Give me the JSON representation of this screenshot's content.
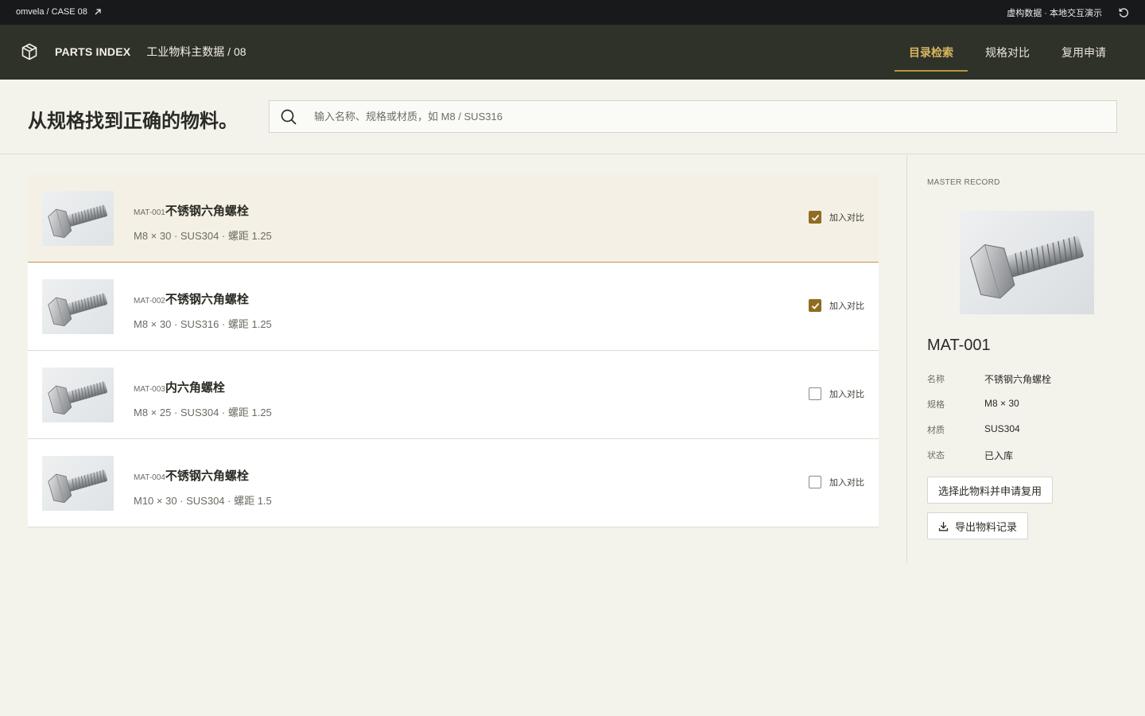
{
  "topbar": {
    "crumb": "omvela / CASE 08",
    "note": "虚构数据 · 本地交互演示"
  },
  "header": {
    "brand": "PARTS INDEX",
    "subtitle": "工业物料主数据 / 08",
    "tabs": [
      {
        "label": "目录检索",
        "active": true
      },
      {
        "label": "规格对比",
        "active": false
      },
      {
        "label": "复用申请",
        "active": false
      }
    ]
  },
  "search": {
    "headline": "从规格找到正确的物料。",
    "placeholder": "输入名称、规格或材质，如 M8 / SUS316",
    "value": ""
  },
  "compare_label": "加入对比",
  "items": [
    {
      "code": "MAT-001",
      "name": "不锈钢六角螺栓",
      "spec": "M8 × 30 · SUS304 · 螺距 1.25",
      "compare": true,
      "selected": true
    },
    {
      "code": "MAT-002",
      "name": "不锈钢六角螺栓",
      "spec": "M8 × 30 · SUS316 · 螺距 1.25",
      "compare": true,
      "selected": false
    },
    {
      "code": "MAT-003",
      "name": "内六角螺栓",
      "spec": "M8 × 25 · SUS304 · 螺距 1.25",
      "compare": false,
      "selected": false
    },
    {
      "code": "MAT-004",
      "name": "不锈钢六角螺栓",
      "spec": "M10 × 30 · SUS304 · 螺距 1.5",
      "compare": false,
      "selected": false
    }
  ],
  "detail": {
    "label": "MASTER RECORD",
    "id": "MAT-001",
    "fields": [
      {
        "k": "名称",
        "v": "不锈钢六角螺栓"
      },
      {
        "k": "规格",
        "v": "M8 × 30"
      },
      {
        "k": "材质",
        "v": "SUS304"
      },
      {
        "k": "状态",
        "v": "已入库"
      }
    ],
    "primary_action": "选择此物料并申请复用",
    "export_action": "导出物料记录"
  },
  "colors": {
    "accent": "#b8933e",
    "checkbox": "#8f6d20",
    "header_bg": "#2e3229",
    "topbar_bg": "#17191a"
  }
}
